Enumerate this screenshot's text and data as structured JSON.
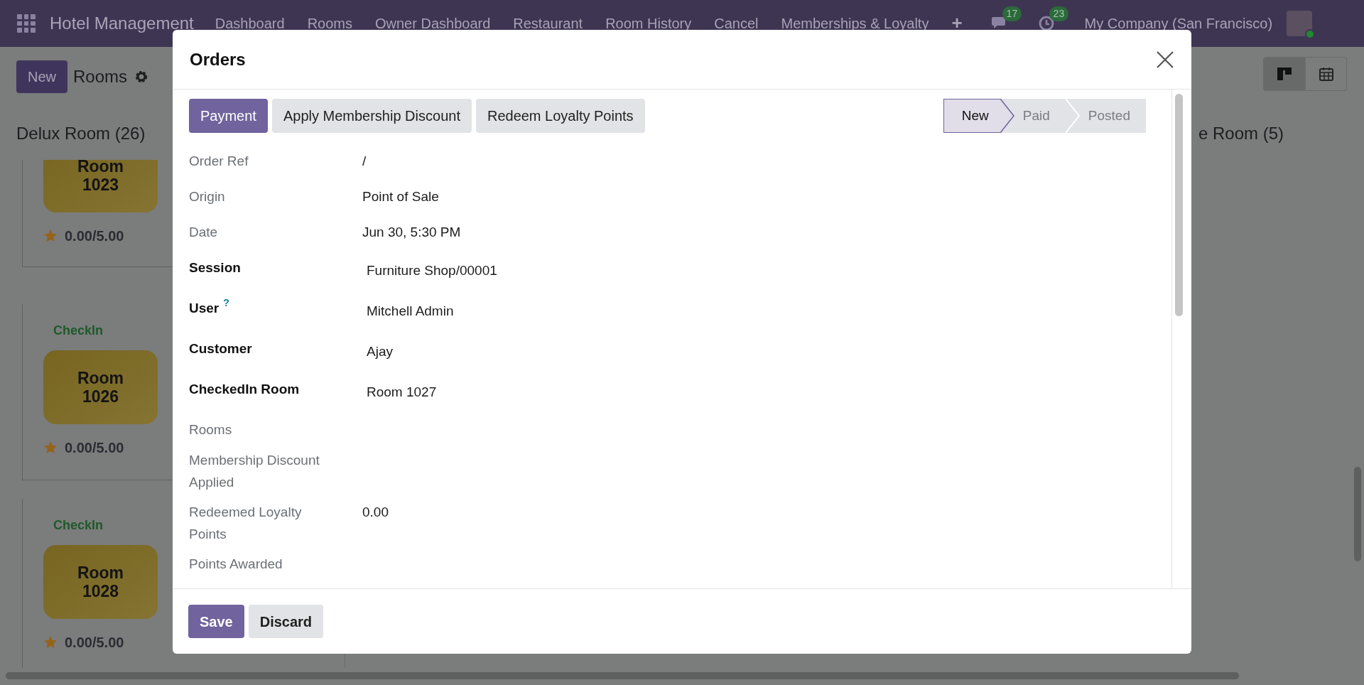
{
  "navbar": {
    "app_name": "Hotel Management",
    "menu": [
      "Dashboard",
      "Rooms",
      "Owner Dashboard",
      "Restaurant",
      "Room History",
      "Cancel",
      "Memberships & Loyalty"
    ],
    "add": "+",
    "messages_count": "17",
    "activities_count": "23",
    "company": "My Company (San Francisco)"
  },
  "control_panel": {
    "new_button": "New",
    "title": "Rooms",
    "views": [
      {
        "kind": "kanban",
        "selected": true
      },
      {
        "kind": "calendar",
        "selected": false
      }
    ]
  },
  "kanban": {
    "columns": [
      {
        "title": "Delux Room (26)",
        "cards": [
          {
            "room": "Room 1023",
            "rating": "0.00/5.00"
          },
          {
            "status": "CheckIn",
            "room": "Room 1026",
            "rating": "0.00/5.00"
          },
          {
            "status": "CheckIn",
            "room": "Room 1028",
            "rating": "0.00/5.00"
          }
        ]
      },
      {
        "title": "e Room (5)"
      }
    ]
  },
  "modal": {
    "title": "Orders",
    "actions": [
      {
        "label": "Payment",
        "primary": true
      },
      {
        "label": "Apply Membership Discount",
        "primary": false
      },
      {
        "label": "Redeem Loyalty Points",
        "primary": false
      }
    ],
    "stages": [
      {
        "label": "New",
        "selected": true
      },
      {
        "label": "Paid",
        "selected": false
      },
      {
        "label": "Posted",
        "selected": false
      }
    ],
    "fields": [
      {
        "label": "Order Ref",
        "value": "/",
        "required": false
      },
      {
        "label": "Origin",
        "value": "Point of Sale",
        "required": false
      },
      {
        "label": "Date",
        "value": "Jun 30, 5:30 PM",
        "required": false
      },
      {
        "label": "Session",
        "value": "Furniture Shop/00001",
        "required": true
      },
      {
        "label": "User",
        "help": "?",
        "value": "Mitchell Admin",
        "required": true
      },
      {
        "label": "Customer",
        "value": "Ajay",
        "required": true
      },
      {
        "label": "CheckedIn Room",
        "value": "Room 1027",
        "required": true
      },
      {
        "label": "Rooms",
        "required": false
      },
      {
        "label": "Membership Discount Applied",
        "required": false
      },
      {
        "label": "Redeemed Loyalty Points",
        "value": "0.00",
        "required": false
      },
      {
        "label": "Points Awarded",
        "required": false
      }
    ],
    "footer": [
      {
        "label": "Save",
        "primary": true
      },
      {
        "label": "Discard",
        "primary": false
      }
    ]
  }
}
